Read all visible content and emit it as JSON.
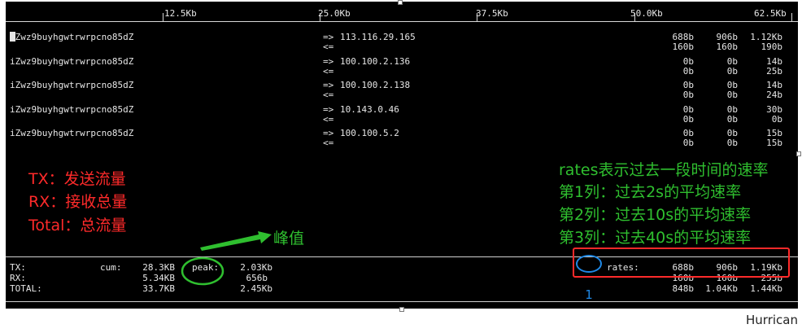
{
  "scale": {
    "ticks": [
      "12.5Kb",
      "25.0Kb",
      "37.5Kb",
      "50.0Kb",
      "62.5Kb"
    ]
  },
  "connections": [
    {
      "host": "iZwz9buyhgwtrwrpcno85dZ",
      "send_arrow": "=>",
      "recv_arrow": "<=",
      "peer": "113.116.29.165",
      "send": [
        "688b",
        "906b",
        "1.12Kb"
      ],
      "recv": [
        "160b",
        "160b",
        "190b"
      ]
    },
    {
      "host": "iZwz9buyhgwtrwrpcno85dZ",
      "send_arrow": "=>",
      "recv_arrow": "<=",
      "peer": "100.100.2.136",
      "send": [
        "0b",
        "0b",
        "14b"
      ],
      "recv": [
        "0b",
        "0b",
        "25b"
      ]
    },
    {
      "host": "iZwz9buyhgwtrwrpcno85dZ",
      "send_arrow": "=>",
      "recv_arrow": "<=",
      "peer": "100.100.2.138",
      "send": [
        "0b",
        "0b",
        "14b"
      ],
      "recv": [
        "0b",
        "0b",
        "24b"
      ]
    },
    {
      "host": "iZwz9buyhgwtrwrpcno85dZ",
      "send_arrow": "=>",
      "recv_arrow": "<=",
      "peer": "10.143.0.46",
      "send": [
        "0b",
        "0b",
        "30b"
      ],
      "recv": [
        "0b",
        "0b",
        "0b"
      ]
    },
    {
      "host": "iZwz9buyhgwtrwrpcno85dZ",
      "send_arrow": "=>",
      "recv_arrow": "<=",
      "peer": "100.100.5.2",
      "send": [
        "0b",
        "0b",
        "15b"
      ],
      "recv": [
        "0b",
        "0b",
        "15b"
      ]
    }
  ],
  "annotations": {
    "left": [
      "TX：发送流量",
      "RX：接收总量",
      "Total：总流量"
    ],
    "right": [
      "rates表示过去一段时间的速率",
      "第1列：过去2s的平均速率",
      "第2列：过去10s的平均速率",
      "第3列：过去40s的平均速率"
    ],
    "peak_label": "峰值",
    "circle_number": "1"
  },
  "summary": {
    "cum_label": "cum:",
    "peak_label": "peak:",
    "rates_label": "rates:",
    "rows": [
      {
        "label": "TX:",
        "cum": "28.3KB",
        "peak": "2.03Kb",
        "rates": [
          "688b",
          "906b",
          "1.19Kb"
        ]
      },
      {
        "label": "RX:",
        "cum": "5.34KB",
        "peak": "656b",
        "rates": [
          "160b",
          "160b",
          "255b"
        ]
      },
      {
        "label": "TOTAL:",
        "cum": "33.7KB",
        "peak": "2.45Kb",
        "rates": [
          "848b",
          "1.04Kb",
          "1.44Kb"
        ]
      }
    ]
  },
  "colors": {
    "red": "#ff2a2a",
    "green": "#2fbf2f",
    "blue": "#1e88e5"
  },
  "watermark": "Hurrican"
}
